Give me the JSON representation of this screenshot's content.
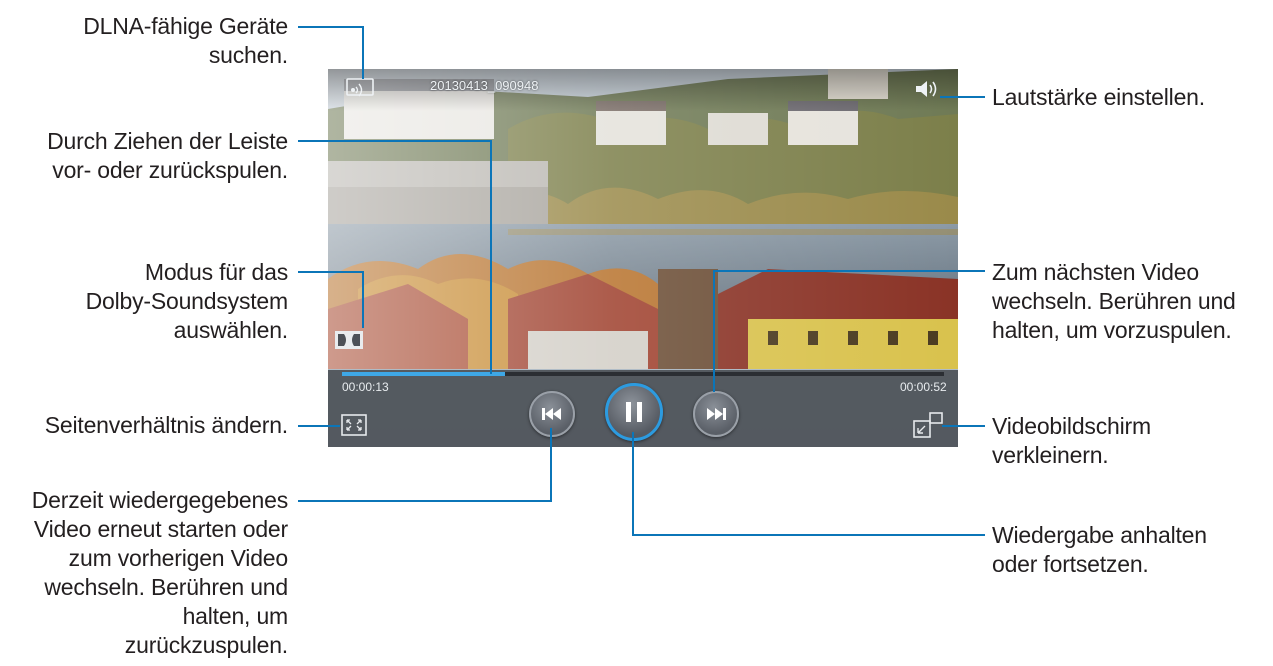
{
  "callouts": {
    "dlna": [
      "DLNA-fähige Geräte",
      "suchen."
    ],
    "seek": [
      "Durch Ziehen der Leiste",
      "vor- oder zurückspulen."
    ],
    "dolby": [
      "Modus für das",
      "Dolby-Soundsystem",
      "auswählen."
    ],
    "aspect": [
      "Seitenverhältnis ändern."
    ],
    "previous": [
      "Derzeit wiedergegebenes",
      "Video erneut starten oder",
      "zum vorherigen Video",
      "wechseln. Berühren und",
      "halten, um",
      "zurückzuspulen."
    ],
    "volume": [
      "Lautstärke einstellen."
    ],
    "next": [
      "Zum nächsten Video",
      "wechseln. Berühren und",
      "halten, um vorzuspulen."
    ],
    "minimize": [
      "Videobildschirm",
      "verkleinern."
    ],
    "play_pause": [
      "Wiedergabe anhalten",
      "oder fortsetzen."
    ]
  },
  "player": {
    "filename": "20130413_090948",
    "elapsed": "00:00:13",
    "duration": "00:00:52",
    "progress_fraction": 0.27
  },
  "icons": {
    "dlna": "dlna-icon",
    "volume": "speaker-icon",
    "dolby": "dolby-icon",
    "aspect": "aspect-ratio-icon",
    "previous": "rewind-icon",
    "play_pause": "pause-icon",
    "next": "fast-forward-icon",
    "minimize": "popup-player-icon"
  },
  "colors": {
    "callout_line": "#0b75b8",
    "progress": "#3ea7e6",
    "play_ring": "#2c9be0"
  }
}
